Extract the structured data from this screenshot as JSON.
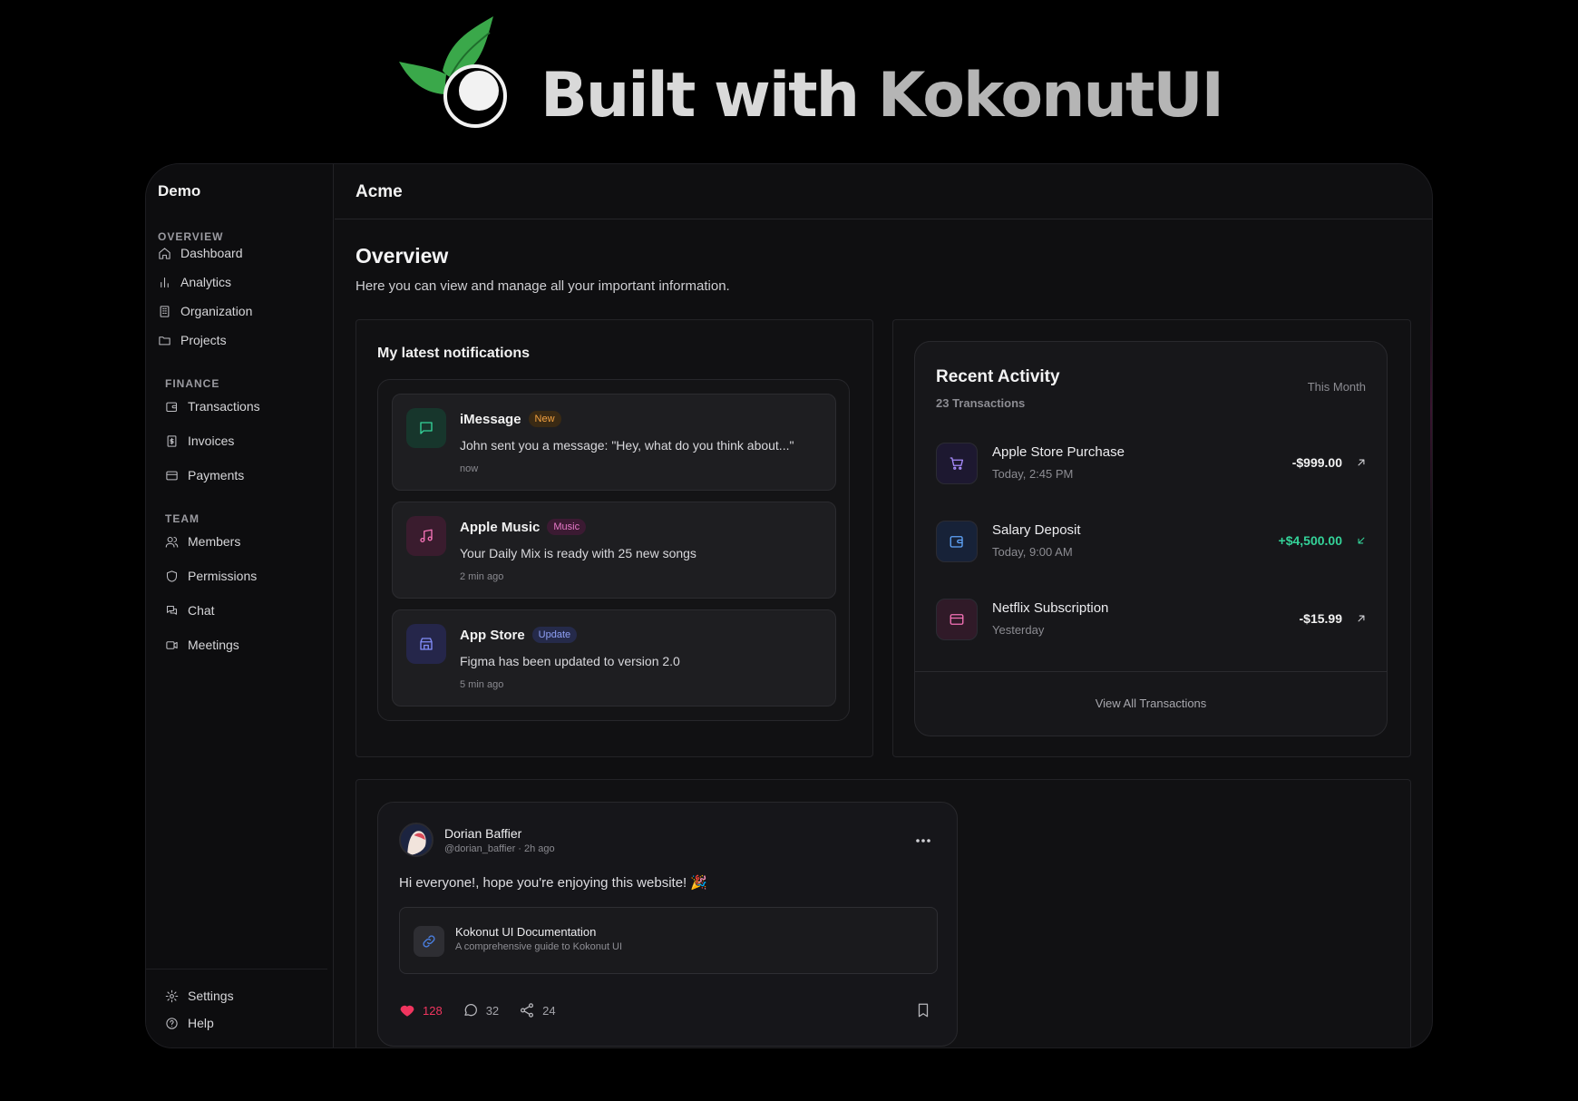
{
  "banner": {
    "prefix": "Built with ",
    "brand": "KokonutUI"
  },
  "sidebar": {
    "brand": "Demo",
    "sections": [
      {
        "label": "OVERVIEW",
        "items": [
          {
            "label": "Dashboard",
            "icon": "home-icon"
          },
          {
            "label": "Analytics",
            "icon": "bar-chart-icon"
          },
          {
            "label": "Organization",
            "icon": "building-icon"
          },
          {
            "label": "Projects",
            "icon": "folder-icon"
          }
        ]
      },
      {
        "label": "FINANCE",
        "items": [
          {
            "label": "Transactions",
            "icon": "wallet-icon"
          },
          {
            "label": "Invoices",
            "icon": "receipt-icon"
          },
          {
            "label": "Payments",
            "icon": "credit-card-icon"
          }
        ]
      },
      {
        "label": "TEAM",
        "items": [
          {
            "label": "Members",
            "icon": "users-icon"
          },
          {
            "label": "Permissions",
            "icon": "shield-icon"
          },
          {
            "label": "Chat",
            "icon": "chat-icon"
          },
          {
            "label": "Meetings",
            "icon": "video-icon"
          }
        ]
      }
    ],
    "footer": [
      {
        "label": "Settings",
        "icon": "gear-icon"
      },
      {
        "label": "Help",
        "icon": "help-icon"
      }
    ]
  },
  "topbar": {
    "title": "Acme",
    "icons": [
      "bell-icon",
      "moon-icon",
      "avatar"
    ]
  },
  "overview": {
    "title": "Overview",
    "description": "Here you can view and manage all your important information."
  },
  "notifications": {
    "title": "My latest notifications",
    "items": [
      {
        "app": "iMessage",
        "badge": "New",
        "message": "John sent you a message: \"Hey, what do you think about...\"",
        "time": "now",
        "icon": "message-icon",
        "accent": "#34d399"
      },
      {
        "app": "Apple Music",
        "badge": "Music",
        "message": "Your Daily Mix is ready with 25 new songs",
        "time": "2 min ago",
        "icon": "music-icon",
        "accent": "#f472b6"
      },
      {
        "app": "App Store",
        "badge": "Update",
        "message": "Figma has been updated to version 2.0",
        "time": "5 min ago",
        "icon": "store-icon",
        "accent": "#818cf8"
      }
    ]
  },
  "activity": {
    "title": "Recent Activity",
    "subtitle": "23 Transactions",
    "period": "This Month",
    "transactions": [
      {
        "name": "Apple Store Purchase",
        "time": "Today, 2:45 PM",
        "amount": "-$999.00",
        "direction": "out",
        "icon": "cart-icon",
        "accent": "#a78bfa"
      },
      {
        "name": "Salary Deposit",
        "time": "Today, 9:00 AM",
        "amount": "+$4,500.00",
        "direction": "in",
        "icon": "wallet-icon",
        "accent": "#60a5fa"
      },
      {
        "name": "Netflix Subscription",
        "time": "Yesterday",
        "amount": "-$15.99",
        "direction": "out",
        "icon": "credit-card-icon",
        "accent": "#f472b6"
      }
    ],
    "link": "View All Transactions"
  },
  "post": {
    "author": "Dorian Baffier",
    "meta": "@dorian_baffier · 2h ago",
    "text": "Hi everyone!, hope you're enjoying this website! 🎉",
    "link_title": "Kokonut UI Documentation",
    "link_desc": "A comprehensive guide to Kokonut UI",
    "likes": "128",
    "comments": "32",
    "shares": "24"
  },
  "colors": {
    "positive": "#34d399",
    "like": "#f0355f"
  }
}
